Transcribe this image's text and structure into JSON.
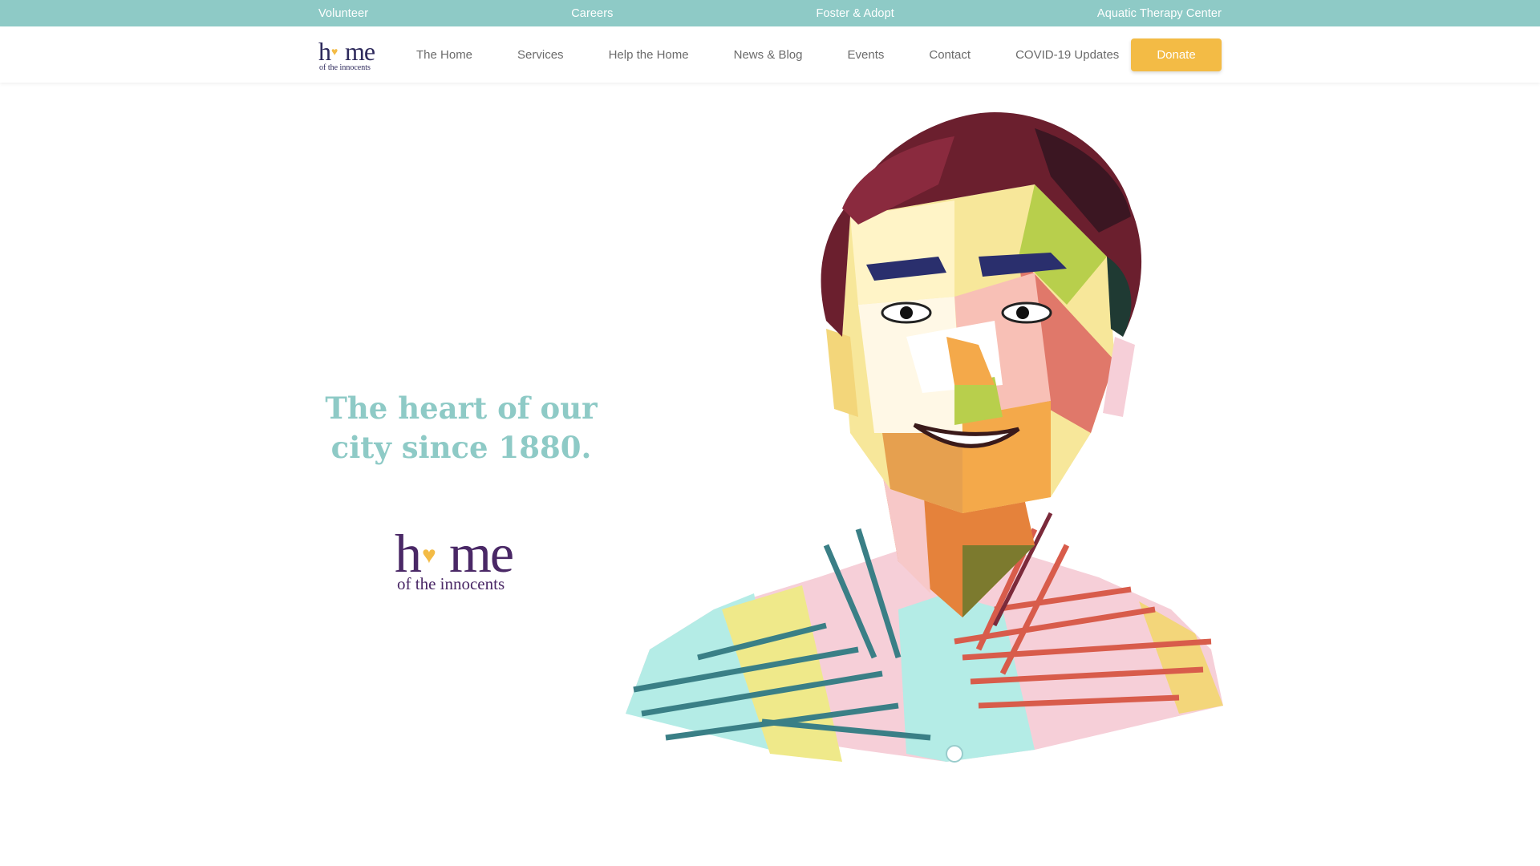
{
  "utility_nav": [
    "Volunteer",
    "Careers",
    "Foster & Adopt",
    "Aquatic Therapy Center"
  ],
  "logo": {
    "word": "hme",
    "sub": "of the innocents"
  },
  "main_nav": [
    "The Home",
    "Services",
    "Help the Home",
    "News & Blog",
    "Events",
    "Contact",
    "COVID-19 Updates"
  ],
  "donate_label": "Donate",
  "hero": {
    "tagline_line1": "The heart of our",
    "tagline_line2": "city since 1880."
  },
  "colors": {
    "utility_bar": "#8ecac6",
    "tagline": "#8ecac6",
    "donate": "#f3bb45",
    "logo_purple": "#4a2866",
    "logo_heart": "#f3bb45"
  }
}
